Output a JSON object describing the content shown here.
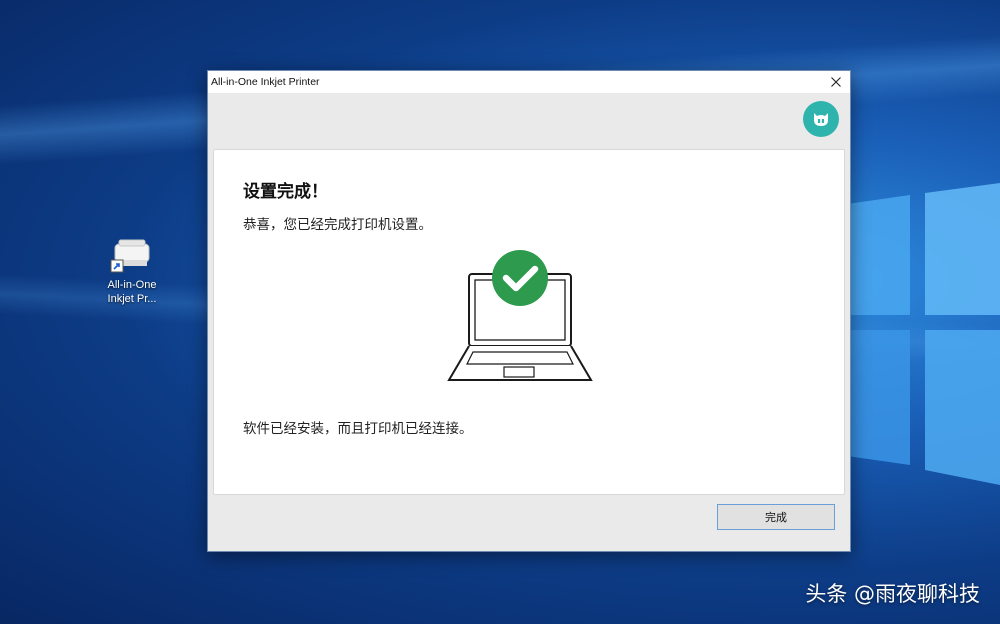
{
  "desktop": {
    "icon": {
      "label_line1": "All-in-One",
      "label_line2": "Inkjet Pr..."
    }
  },
  "dialog": {
    "title": "All-in-One Inkjet Printer",
    "heading": "设置完成！",
    "subtext": "恭喜，您已经完成打印机设置。",
    "footer_text": "软件已经安装，而且打印机已经连接。",
    "finish_button": "完成",
    "close_icon": "close-icon",
    "logo_icon": "mi-logo-icon"
  },
  "watermark": "头条 @雨夜聊科技",
  "colors": {
    "accent_teal": "#2fb3ad",
    "check_green": "#2e9a4e",
    "button_border": "#6aa0d8"
  }
}
